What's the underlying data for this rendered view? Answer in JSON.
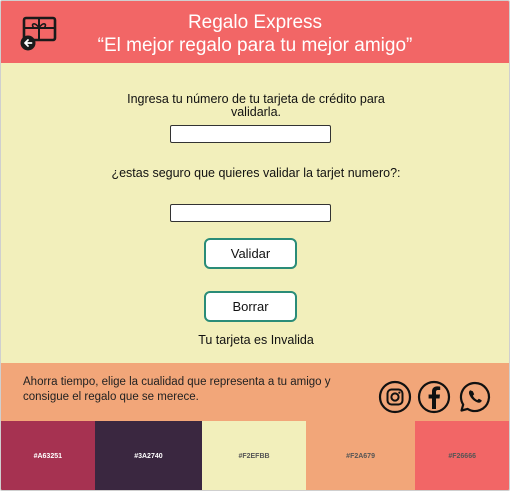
{
  "header": {
    "title": "Regalo Express",
    "subtitle": "“El mejor regalo para tu mejor amigo”",
    "background": "#F26666"
  },
  "form": {
    "card_label": "Ingresa tu número de tu tarjeta de crédito para validarla.",
    "card_value": "",
    "confirm_label": "¿estas seguro que quieres validar la tarjet numero?:",
    "confirm_value": "",
    "validate_button": "Validar",
    "clear_button": "Borrar",
    "result_text": "Tu tarjeta es Invalida"
  },
  "footer": {
    "text": "Ahorra tiempo, elige la cualidad que representa a tu amigo y consigue el regalo que se merece.",
    "icons": [
      "instagram-icon",
      "facebook-icon",
      "whatsapp-icon"
    ],
    "background": "#F2A679"
  },
  "palette": [
    {
      "label": "#A63251",
      "color": "#A63251",
      "text_color": "#ffffff"
    },
    {
      "label": "#3A2740",
      "color": "#3A2740",
      "text_color": "#ffffff"
    },
    {
      "label": "#F2EFBB",
      "color": "#F2EFBB",
      "text_color": "#555555"
    },
    {
      "label": "#F2A679",
      "color": "#F2A679",
      "text_color": "#555555"
    },
    {
      "label": "#F26666",
      "color": "#F26666",
      "text_color": "#555555"
    }
  ]
}
